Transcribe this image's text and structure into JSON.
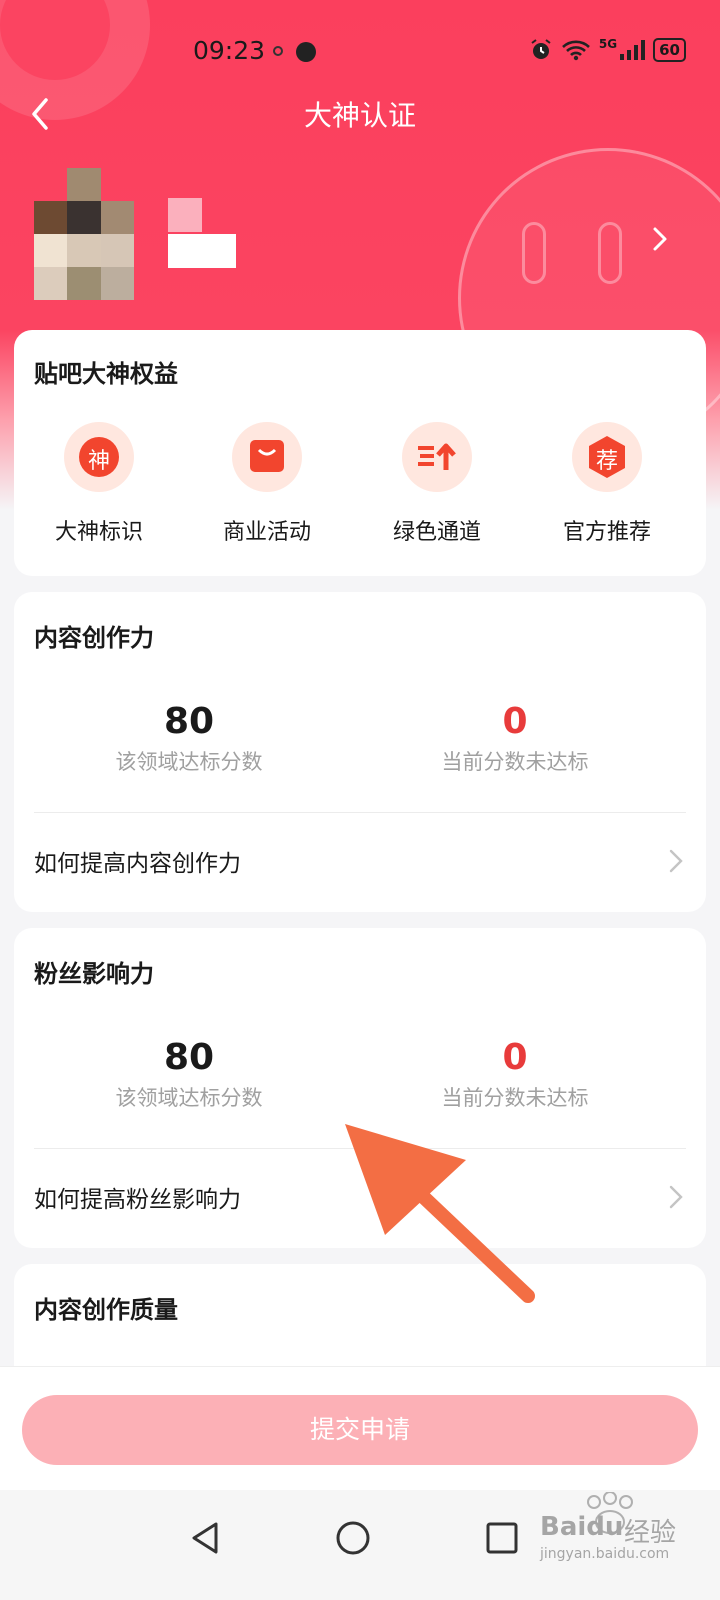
{
  "status_bar": {
    "time": "09:23",
    "network": "5G",
    "battery": "60"
  },
  "header": {
    "title": "大神认证"
  },
  "benefits": {
    "title": "贴吧大神权益",
    "items": [
      {
        "label": "大神标识",
        "icon": "shen-badge-icon",
        "glyph": "神"
      },
      {
        "label": "商业活动",
        "icon": "shopping-bag-icon",
        "glyph": ""
      },
      {
        "label": "绿色通道",
        "icon": "fast-track-icon",
        "glyph": ""
      },
      {
        "label": "官方推荐",
        "icon": "recommend-icon",
        "glyph": "荐"
      }
    ]
  },
  "sections": [
    {
      "title": "内容创作力",
      "target_score": "80",
      "target_label": "该领域达标分数",
      "current_score": "0",
      "current_label": "当前分数未达标",
      "link": "如何提高内容创作力"
    },
    {
      "title": "粉丝影响力",
      "target_score": "80",
      "target_label": "该领域达标分数",
      "current_score": "0",
      "current_label": "当前分数未达标",
      "link": "如何提高粉丝影响力"
    },
    {
      "title": "内容创作质量"
    }
  ],
  "footer": {
    "submit_label": "提交申请"
  },
  "watermark": {
    "brand": "Baidu",
    "brand_cn": "经验",
    "url": "jingyan.baidu.com"
  },
  "colors": {
    "primary_red": "#fb4461",
    "score_fail": "#e83b3b",
    "button_disabled": "#fcb0b6",
    "annotation_arrow": "#f36e44"
  }
}
